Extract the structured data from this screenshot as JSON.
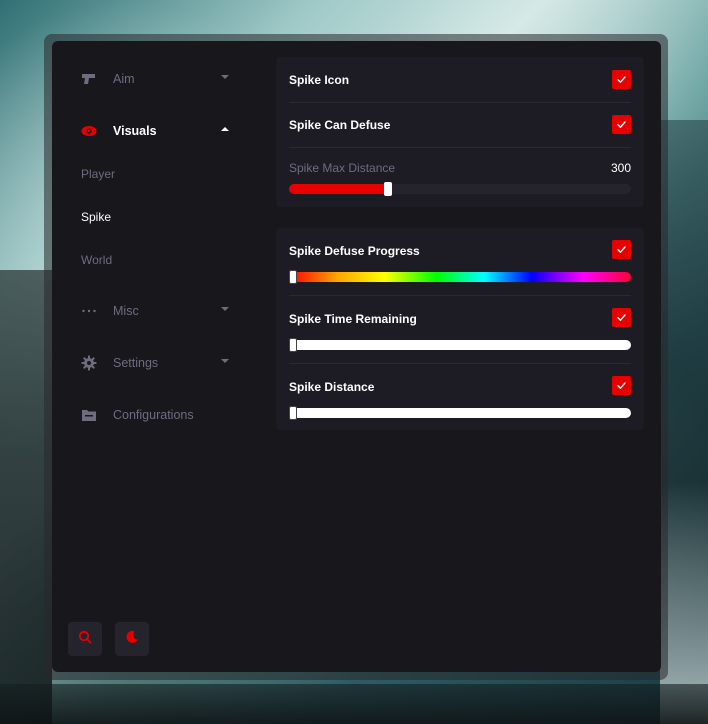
{
  "theme": {
    "accent": "#e60000",
    "window_bg": "#17171c",
    "panel_bg": "#1d1c24",
    "text_primary": "#ffffff",
    "text_muted": "#6e6c7f"
  },
  "sidebar": {
    "items": [
      {
        "label": "Aim",
        "icon": "gun-icon",
        "active": false,
        "expanded": false
      },
      {
        "label": "Visuals",
        "icon": "eye-icon",
        "active": true,
        "expanded": true
      },
      {
        "label": "Misc",
        "icon": "dots-icon",
        "active": false,
        "expanded": false
      },
      {
        "label": "Settings",
        "icon": "gear-icon",
        "active": false,
        "expanded": false
      },
      {
        "label": "Configurations",
        "icon": "folder-icon",
        "active": false,
        "expanded": false
      }
    ],
    "visuals_sub": [
      {
        "label": "Player",
        "active": false
      },
      {
        "label": "Spike",
        "active": true
      },
      {
        "label": "World",
        "active": false
      }
    ],
    "bottom_buttons": [
      {
        "icon": "search-icon"
      },
      {
        "icon": "moon-icon"
      }
    ]
  },
  "panel1": {
    "spike_icon": {
      "label": "Spike Icon",
      "checked": true
    },
    "spike_can_defuse": {
      "label": "Spike Can Defuse",
      "checked": true
    },
    "spike_max_distance": {
      "label": "Spike Max Distance",
      "value": "300",
      "fraction": 0.29
    }
  },
  "panel2": {
    "defuse_progress": {
      "label": "Spike Defuse Progress",
      "checked": true,
      "picker": "rainbow",
      "knob_fraction": 0.0
    },
    "time_remaining": {
      "label": "Spike Time Remaining",
      "checked": true,
      "picker": "white",
      "knob_fraction": 0.0
    },
    "spike_distance": {
      "label": "Spike Distance",
      "checked": true,
      "picker": "white",
      "knob_fraction": 0.0
    }
  }
}
